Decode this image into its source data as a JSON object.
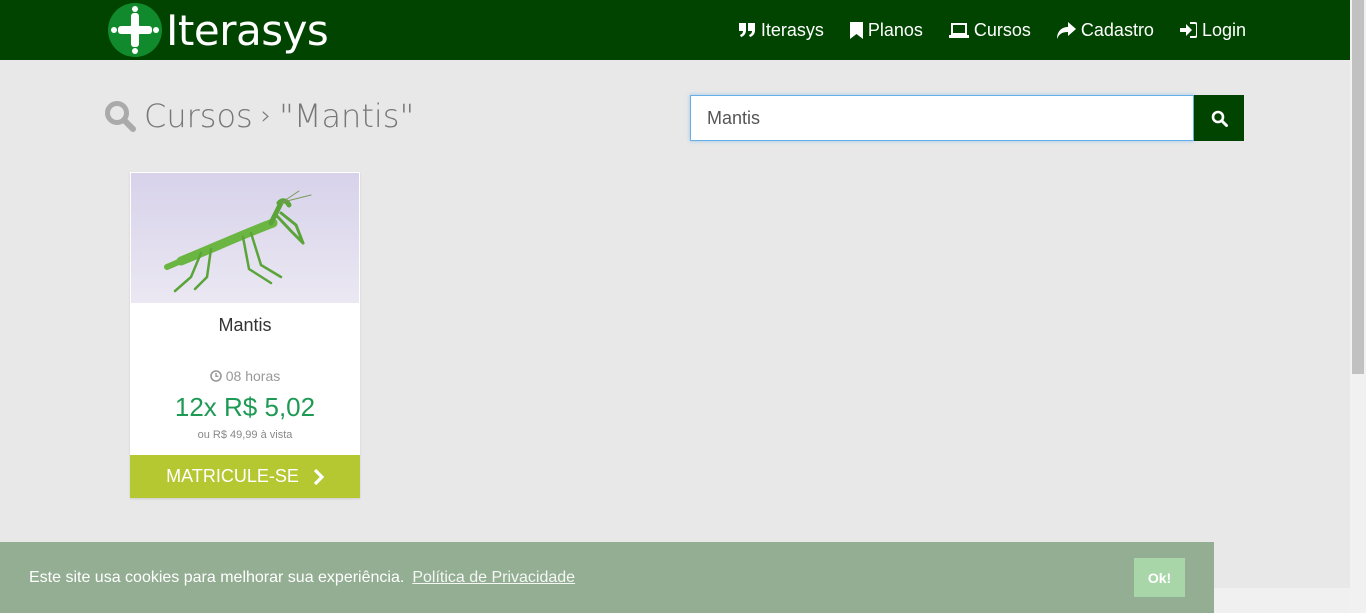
{
  "brand": {
    "name": "Iterasys"
  },
  "nav": {
    "items": [
      {
        "label": "Iterasys",
        "icon": "quote-icon"
      },
      {
        "label": "Planos",
        "icon": "bookmark-icon"
      },
      {
        "label": "Cursos",
        "icon": "laptop-icon"
      },
      {
        "label": "Cadastro",
        "icon": "share-arrow-icon"
      },
      {
        "label": "Login",
        "icon": "sign-in-icon"
      }
    ]
  },
  "heading": {
    "section": "Cursos",
    "separator": "›",
    "query": "\"Mantis\""
  },
  "search": {
    "value": "Mantis",
    "button_icon": "search-icon"
  },
  "course": {
    "title": "Mantis",
    "duration": "08 horas",
    "price": "12x R$ 5,02",
    "price_note": "ou R$ 49,99 à vista",
    "enroll_label": "MATRICULE-SE"
  },
  "cookie": {
    "message": "Este site usa cookies para melhorar sua experiência.",
    "link": "Política de Privacidade",
    "ok_label": "Ok!"
  },
  "colors": {
    "navbar": "#004400",
    "enroll": "#b5c832",
    "price": "#1e9a55",
    "cookie_bar": "#93ae93"
  }
}
